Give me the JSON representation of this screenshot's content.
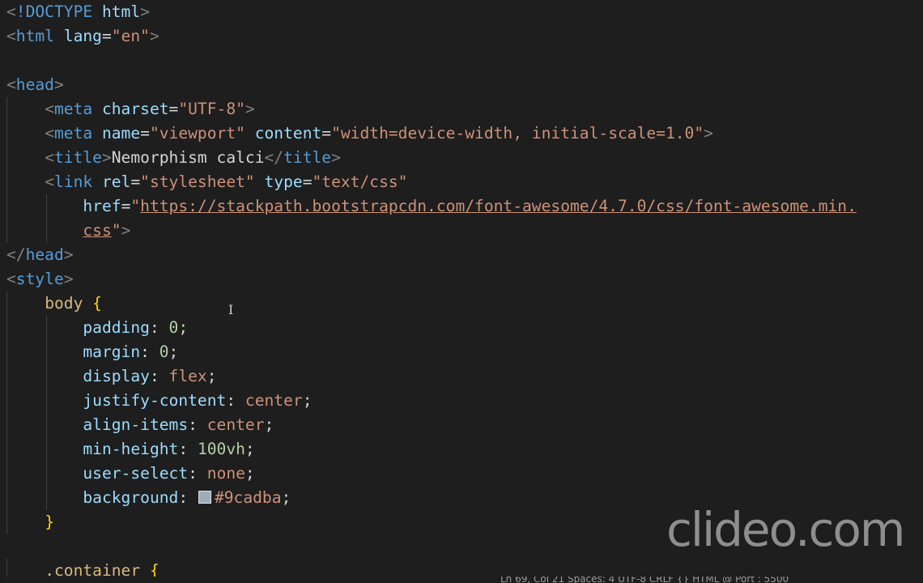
{
  "editor": {
    "language": "html",
    "lines": [
      {
        "tokens": [
          [
            "c-punc",
            "<"
          ],
          [
            "c-tag",
            "!DOCTYPE"
          ],
          [
            "c-text",
            " "
          ],
          [
            "c-attr",
            "html"
          ],
          [
            "c-punc",
            ">"
          ]
        ]
      },
      {
        "tokens": [
          [
            "c-punc",
            "<"
          ],
          [
            "c-tag",
            "html"
          ],
          [
            "c-text",
            " "
          ],
          [
            "c-attr",
            "lang"
          ],
          [
            "c-text",
            "="
          ],
          [
            "c-str",
            "\"en\""
          ],
          [
            "c-punc",
            ">"
          ]
        ]
      },
      {
        "tokens": []
      },
      {
        "tokens": [
          [
            "c-punc",
            "<"
          ],
          [
            "c-tag",
            "head"
          ],
          [
            "c-punc",
            ">"
          ]
        ]
      },
      {
        "indent": 1,
        "tokens": [
          [
            "c-text",
            "    "
          ],
          [
            "c-punc",
            "<"
          ],
          [
            "c-tag",
            "meta"
          ],
          [
            "c-text",
            " "
          ],
          [
            "c-attr",
            "charset"
          ],
          [
            "c-text",
            "="
          ],
          [
            "c-str",
            "\"UTF-8\""
          ],
          [
            "c-punc",
            ">"
          ]
        ]
      },
      {
        "indent": 1,
        "tokens": [
          [
            "c-text",
            "    "
          ],
          [
            "c-punc",
            "<"
          ],
          [
            "c-tag",
            "meta"
          ],
          [
            "c-text",
            " "
          ],
          [
            "c-attr",
            "name"
          ],
          [
            "c-text",
            "="
          ],
          [
            "c-str",
            "\"viewport\""
          ],
          [
            "c-text",
            " "
          ],
          [
            "c-attr",
            "content"
          ],
          [
            "c-text",
            "="
          ],
          [
            "c-str",
            "\"width=device-width, initial-scale=1.0\""
          ],
          [
            "c-punc",
            ">"
          ]
        ]
      },
      {
        "indent": 1,
        "tokens": [
          [
            "c-text",
            "    "
          ],
          [
            "c-punc",
            "<"
          ],
          [
            "c-tag",
            "title"
          ],
          [
            "c-punc",
            ">"
          ],
          [
            "c-text",
            "Nemorphism calci"
          ],
          [
            "c-punc",
            "</"
          ],
          [
            "c-tag",
            "title"
          ],
          [
            "c-punc",
            ">"
          ]
        ]
      },
      {
        "indent": 1,
        "tokens": [
          [
            "c-text",
            "    "
          ],
          [
            "c-punc",
            "<"
          ],
          [
            "c-tag",
            "link"
          ],
          [
            "c-text",
            " "
          ],
          [
            "c-attr",
            "rel"
          ],
          [
            "c-text",
            "="
          ],
          [
            "c-str",
            "\"stylesheet\""
          ],
          [
            "c-text",
            " "
          ],
          [
            "c-attr",
            "type"
          ],
          [
            "c-text",
            "="
          ],
          [
            "c-str",
            "\"text/css\""
          ]
        ]
      },
      {
        "indent": 2,
        "tokens": [
          [
            "c-text",
            "        "
          ],
          [
            "c-attr",
            "href"
          ],
          [
            "c-text",
            "="
          ],
          [
            "c-str",
            "\""
          ],
          [
            "c-link",
            "https://stackpath.bootstrapcdn.com/font-awesome/4.7.0/css/font-awesome.min."
          ]
        ]
      },
      {
        "indent": 2,
        "tokens": [
          [
            "c-text",
            "        "
          ],
          [
            "c-link",
            "css"
          ],
          [
            "c-str",
            "\""
          ],
          [
            "c-punc",
            ">"
          ]
        ]
      },
      {
        "tokens": [
          [
            "c-punc",
            "</"
          ],
          [
            "c-tag",
            "head"
          ],
          [
            "c-punc",
            ">"
          ]
        ]
      },
      {
        "tokens": [
          [
            "c-punc",
            "<"
          ],
          [
            "c-tag",
            "style"
          ],
          [
            "c-punc",
            ">"
          ]
        ]
      },
      {
        "indent": 1,
        "tokens": [
          [
            "c-text",
            "    "
          ],
          [
            "c-sel",
            "body"
          ],
          [
            "c-text",
            " "
          ],
          [
            "c-brace",
            "{"
          ]
        ]
      },
      {
        "indent": 2,
        "tokens": [
          [
            "c-text",
            "        "
          ],
          [
            "c-prop",
            "padding"
          ],
          [
            "c-text",
            ": "
          ],
          [
            "c-num",
            "0"
          ],
          [
            "c-text",
            ";"
          ]
        ]
      },
      {
        "indent": 2,
        "tokens": [
          [
            "c-text",
            "        "
          ],
          [
            "c-prop",
            "margin"
          ],
          [
            "c-text",
            ": "
          ],
          [
            "c-num",
            "0"
          ],
          [
            "c-text",
            ";"
          ]
        ]
      },
      {
        "indent": 2,
        "tokens": [
          [
            "c-text",
            "        "
          ],
          [
            "c-prop",
            "display"
          ],
          [
            "c-text",
            ": "
          ],
          [
            "c-val",
            "flex"
          ],
          [
            "c-text",
            ";"
          ]
        ]
      },
      {
        "indent": 2,
        "tokens": [
          [
            "c-text",
            "        "
          ],
          [
            "c-prop",
            "justify-content"
          ],
          [
            "c-text",
            ": "
          ],
          [
            "c-val",
            "center"
          ],
          [
            "c-text",
            ";"
          ]
        ]
      },
      {
        "indent": 2,
        "tokens": [
          [
            "c-text",
            "        "
          ],
          [
            "c-prop",
            "align-items"
          ],
          [
            "c-text",
            ": "
          ],
          [
            "c-val",
            "center"
          ],
          [
            "c-text",
            ";"
          ]
        ]
      },
      {
        "indent": 2,
        "tokens": [
          [
            "c-text",
            "        "
          ],
          [
            "c-prop",
            "min-height"
          ],
          [
            "c-text",
            ": "
          ],
          [
            "c-num",
            "100vh"
          ],
          [
            "c-text",
            ";"
          ]
        ]
      },
      {
        "indent": 2,
        "tokens": [
          [
            "c-text",
            "        "
          ],
          [
            "c-prop",
            "user-select"
          ],
          [
            "c-text",
            ": "
          ],
          [
            "c-val",
            "none"
          ],
          [
            "c-text",
            ";"
          ]
        ]
      },
      {
        "indent": 2,
        "tokens": [
          [
            "c-text",
            "        "
          ],
          [
            "c-prop",
            "background"
          ],
          [
            "c-text",
            ": "
          ],
          [
            "swatch",
            "#9cadba"
          ],
          [
            "c-val",
            "#9cadba"
          ],
          [
            "c-text",
            ";"
          ]
        ]
      },
      {
        "indent": 1,
        "tokens": [
          [
            "c-text",
            "    "
          ],
          [
            "c-brace",
            "}"
          ]
        ]
      },
      {
        "tokens": []
      },
      {
        "indent": 1,
        "tokens": [
          [
            "c-text",
            "    "
          ],
          [
            "c-sel",
            ".container"
          ],
          [
            "c-text",
            " "
          ],
          [
            "c-brace",
            "{"
          ]
        ]
      }
    ]
  },
  "watermark": {
    "text": "clideo.com"
  },
  "statusbar": {
    "text": "Ln 69, Col 21    Spaces: 4    UTF-8    CRLF    {} HTML    @ Port : 5500"
  },
  "colors": {
    "background": "#1e1e1e",
    "swatch": "#9cadba"
  }
}
